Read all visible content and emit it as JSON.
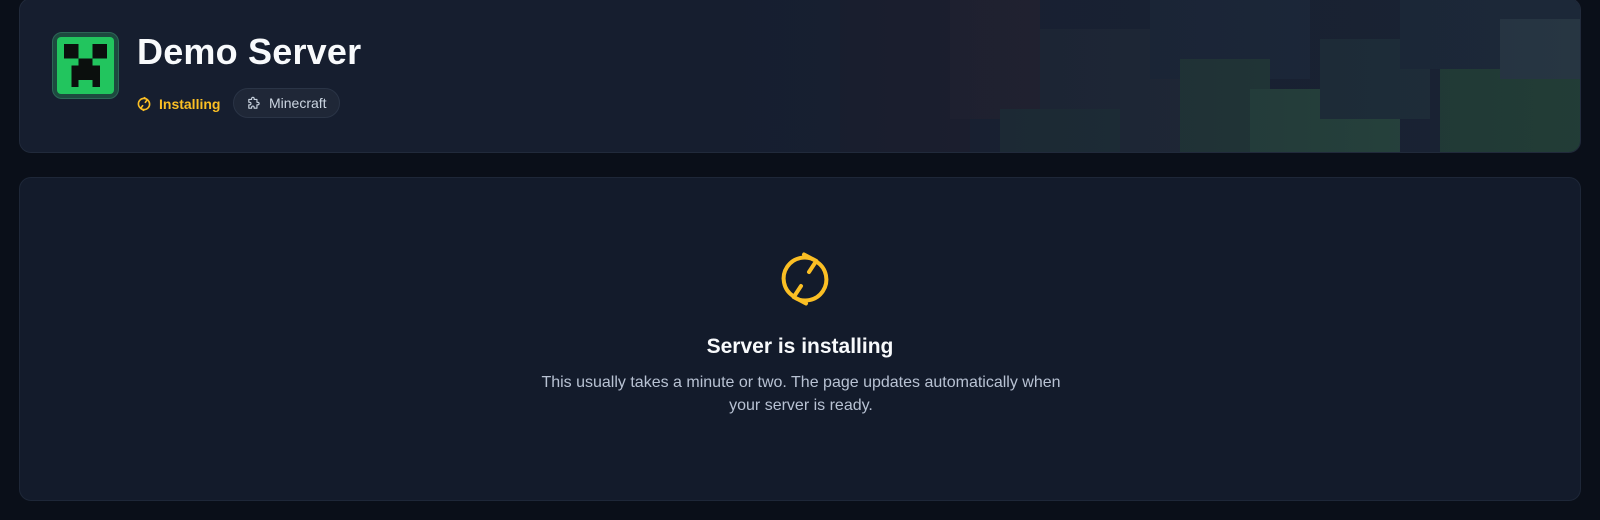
{
  "server": {
    "name": "Demo Server",
    "status_label": "Installing",
    "game_label": "Minecraft"
  },
  "install": {
    "title": "Server is installing",
    "description": "This usually takes a minute or two. The page updates automatically when your server is ready."
  },
  "icons": {
    "server_icon": "creeper-face-icon",
    "status_icon": "refresh-icon",
    "game_icon": "puzzle-piece-icon",
    "install_icon": "refresh-icon"
  },
  "colors": {
    "background": "#0a0f19",
    "card": "#131b2b",
    "header_card": "#161e2f",
    "status_accent": "#fbbf24",
    "server_icon_green": "#22c55e"
  }
}
